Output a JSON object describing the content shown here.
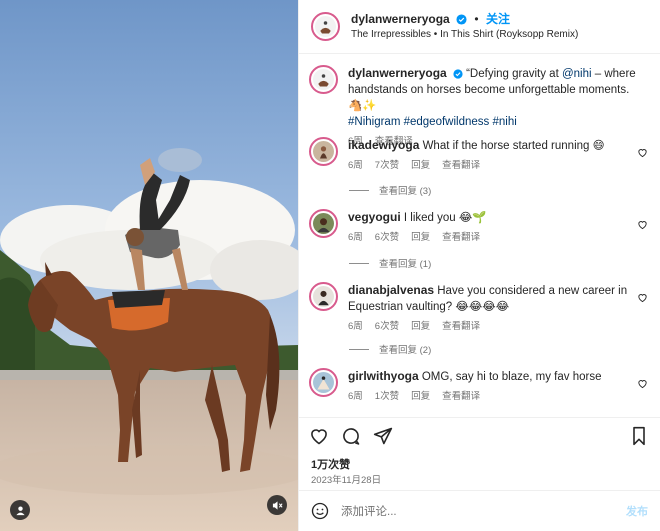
{
  "post": {
    "author": "dylanwerneryoga",
    "follow_label": "关注",
    "separator": "•",
    "audio": "The Irrepressibles • In This Shirt (Royksopp Remix)"
  },
  "caption": {
    "author": "dylanwerneryoga",
    "line1_pre": " “Defying gravity at ",
    "mention": "@nihi",
    "line1_post": " – where",
    "line2": "handstands on horses become unforgettable moments. 🐴✨",
    "hashtags": "#Nihigram #edgeofwildness #nihi",
    "time": "6周",
    "translate": "查看翻译"
  },
  "comments": [
    {
      "user": "ikadewiyoga",
      "text": " What if the horse started running 😄",
      "time": "6周",
      "likes": "7次赞",
      "reply": "回复",
      "translate": "查看翻译",
      "view_replies": "查看回复 (3)"
    },
    {
      "user": "vegyogui",
      "text": " I liked you 😂🌱",
      "time": "6周",
      "likes": "6次赞",
      "reply": "回复",
      "translate": "查看翻译",
      "view_replies": "查看回复 (1)"
    },
    {
      "user": "dianabjalvenas",
      "text_line1": " Have you considered a new career in",
      "text_line2": "Equestrian vaulting? 😂😂😂😂",
      "time": "6周",
      "likes": "6次赞",
      "reply": "回复",
      "translate": "查看翻译",
      "view_replies": "查看回复 (2)"
    },
    {
      "user": "girlwithyoga",
      "text": " OMG, say hi to blaze, my fav horse",
      "time": "6周",
      "likes": "1次赞",
      "reply": "回复",
      "translate": "查看翻译"
    }
  ],
  "actions": {
    "likes": "1万次赞",
    "date": "2023年11月28日"
  },
  "comment_box": {
    "placeholder": "添加评论...",
    "post_label": "发布"
  },
  "icons": [
    "verified-badge-icon",
    "heart-icon",
    "comment-icon",
    "share-icon",
    "bookmark-icon",
    "emoji-icon",
    "user-tag-icon",
    "mute-icon"
  ],
  "colors": {
    "link": "#0095f6",
    "hashtag": "#00376b",
    "muted": "#737373",
    "post_disabled": "#b2dffc"
  }
}
